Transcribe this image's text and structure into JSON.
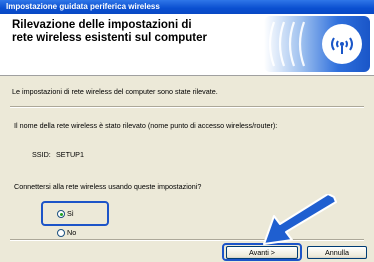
{
  "window": {
    "title": "Impostazione guidata periferica wireless"
  },
  "header": {
    "title_line1": "Rilevazione delle impostazioni di",
    "title_line2": "rete wireless esistenti sul computer",
    "logo_icon": "wireless-signal-icon"
  },
  "body": {
    "detected_message": "Le impostazioni di rete wireless del computer sono state rilevate.",
    "network_name_message": "Il nome della rete wireless è stato rilevato (nome punto di accesso wireless/router):",
    "ssid_label": "SSID:",
    "ssid_value": "SETUP1",
    "question": "Connettersi alla rete wireless usando queste impostazioni?"
  },
  "options": {
    "yes_label": "Sì",
    "no_label": "No",
    "selected": "Sì"
  },
  "buttons": {
    "next_label": "Avanti >",
    "cancel_label": "Annulla"
  },
  "colors": {
    "titlebar": "#0a4fd0",
    "highlight": "#1c54c8",
    "arrow": "#1f5fd0"
  }
}
